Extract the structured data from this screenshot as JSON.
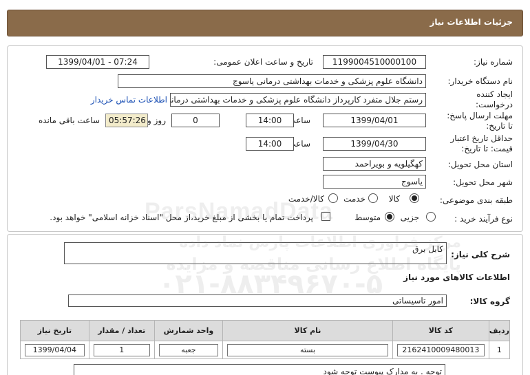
{
  "header": {
    "title": "جزئیات اطلاعات نیاز"
  },
  "form": {
    "need_number_label": "شماره نیاز:",
    "need_number": "1199004510000100",
    "announce_label": "تاریخ و ساعت اعلان عمومی:",
    "announce_value": "1399/04/01 - 07:24",
    "buyer_org_label": "نام دستگاه خریدار:",
    "buyer_org": "دانشگاه علوم پزشکی و خدمات بهداشتی درمانی یاسوج",
    "creator_label_1": "ایجاد کننده",
    "creator_label_2": "درخواست:",
    "creator": "رستم جلال متفرد کارپرداز دانشگاه علوم پزشکی و خدمات بهداشتی درمانی یاس",
    "contact_link": "اطلاعات تماس خریدار",
    "reply_deadline_label_1": "مهلت ارسال پاسخ:",
    "reply_deadline_label_2": "تا تاریخ:",
    "reply_date": "1399/04/01",
    "time_label": "ساعت",
    "reply_time": "14:00",
    "days": "0",
    "days_label": "روز و",
    "remaining": "05:57:26",
    "remaining_label": "ساعت باقی مانده",
    "validity_label_1": "حداقل تاریخ اعتبار",
    "validity_label_2": "قیمت: تا تاریخ:",
    "validity_date": "1399/04/30",
    "validity_time_label": "ساعت",
    "validity_time": "14:00",
    "province_label": "استان محل تحویل:",
    "province": "کهگیلویه و بویراحمد",
    "city_label": "شهر محل تحویل:",
    "city": "یاسوج",
    "category_label": "طبقه بندی موضوعی:",
    "category_options": [
      "کالا",
      "خدمت",
      "کالا/خدمت"
    ],
    "category_selected": "کالا",
    "process_label": "نوع فرآیند خرید :",
    "process_options": [
      "جزیی",
      "متوسط"
    ],
    "process_selected": "متوسط",
    "payment_note": "پرداخت تمام یا بخشی از مبلغ خرید،از محل \"اسناد خزانه اسلامی\" خواهد بود."
  },
  "summary": {
    "general_desc_label": "شرح کلی نیاز:",
    "general_desc": "کابل برق",
    "items_info_title": "اطلاعات کالاهای مورد نیاز",
    "goods_group_label": "گروه کالا:",
    "goods_group": "امور تاسیساتی",
    "table": {
      "headers": [
        "ردیف",
        "کد کالا",
        "نام کالا",
        "واحد شمارش",
        "تعداد / مقدار",
        "تاریخ نیاز"
      ],
      "rows": [
        [
          "1",
          "2162410009480013",
          "بسته",
          "جعبه",
          "1",
          "1399/04/04"
        ]
      ]
    },
    "note": "توجه . به مدارک پیوست توجه شود"
  },
  "watermark": {
    "brand": "ParsNamadData",
    "line1": "مرکز فراوری اطلاعات پارس نماد داده",
    "line2": "پایگاه اطلاع رسانی مناقصه و مزایده",
    "phone": "۰۲۱-۸۸۳۴۹۶۷۰-۵"
  },
  "colors": {
    "titlebar": "#8a6b4a",
    "link": "#1a4fb4",
    "remaining_bg": "#f3eccb"
  }
}
